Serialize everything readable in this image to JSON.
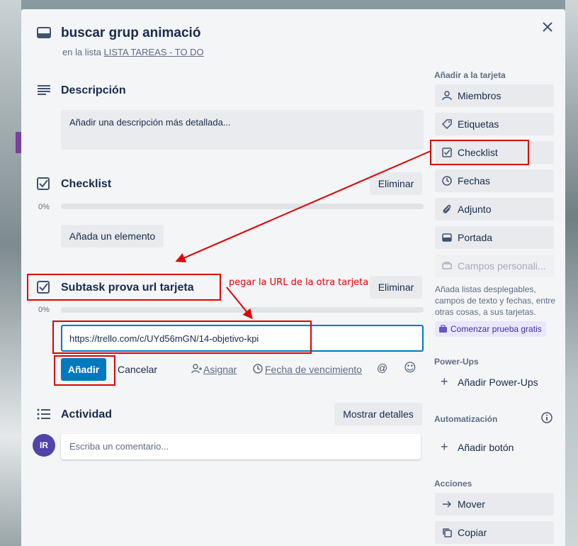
{
  "card": {
    "title": "buscar grup animació",
    "list_prefix": "en la lista",
    "list_name": "LISTA TAREAS - TO DO"
  },
  "description": {
    "heading": "Descripción",
    "placeholder": "Añadir una descripción más detallada..."
  },
  "checklist1": {
    "heading": "Checklist",
    "delete_label": "Eliminar",
    "progress": "0%",
    "add_item_label": "Añada un elemento"
  },
  "checklist2": {
    "heading": "Subtask prova url tarjeta",
    "delete_label": "Eliminar",
    "progress": "0%",
    "input_value": "https://trello.com/c/UYd56mGN/14-objetivo-kpi",
    "add_label": "Añadir",
    "cancel_label": "Cancelar",
    "assign_label": "Asignar",
    "due_label": "Fecha de vencimiento",
    "mention_symbol": "@",
    "emoji_symbol": "☺"
  },
  "annotation": {
    "text": "pegar la URL de la otra tarjeta",
    "color": "#e00000"
  },
  "activity": {
    "heading": "Actividad",
    "show_details_label": "Mostrar detalles",
    "avatar_initials": "IR",
    "comment_placeholder": "Escriba un comentario..."
  },
  "sidebar": {
    "add_to_card_label": "Añadir a la tarjeta",
    "items": [
      {
        "label": "Miembros",
        "icon": "person-icon"
      },
      {
        "label": "Etiquetas",
        "icon": "tag-icon"
      },
      {
        "label": "Checklist",
        "icon": "checkbox-icon"
      },
      {
        "label": "Fechas",
        "icon": "clock-icon"
      },
      {
        "label": "Adjunto",
        "icon": "paperclip-icon"
      },
      {
        "label": "Portada",
        "icon": "card-cover-icon"
      },
      {
        "label": "Campos personali...",
        "icon": "custom-fields-icon"
      }
    ],
    "custom_fields_text": "Añada listas desplegables, campos de texto y fechas, entre otras cosas, a sus tarjetas.",
    "trial_label": "Comenzar prueba gratis",
    "powerups_label": "Power-Ups",
    "add_powerups_label": "Añadir Power-Ups",
    "automation_label": "Automatización",
    "add_button_label": "Añadir botón",
    "actions_label": "Acciones",
    "move_label": "Mover",
    "copy_label": "Copiar"
  },
  "colors": {
    "accent": "#0079bf",
    "annotation_red": "#e00000",
    "avatar": "#5243aa"
  }
}
